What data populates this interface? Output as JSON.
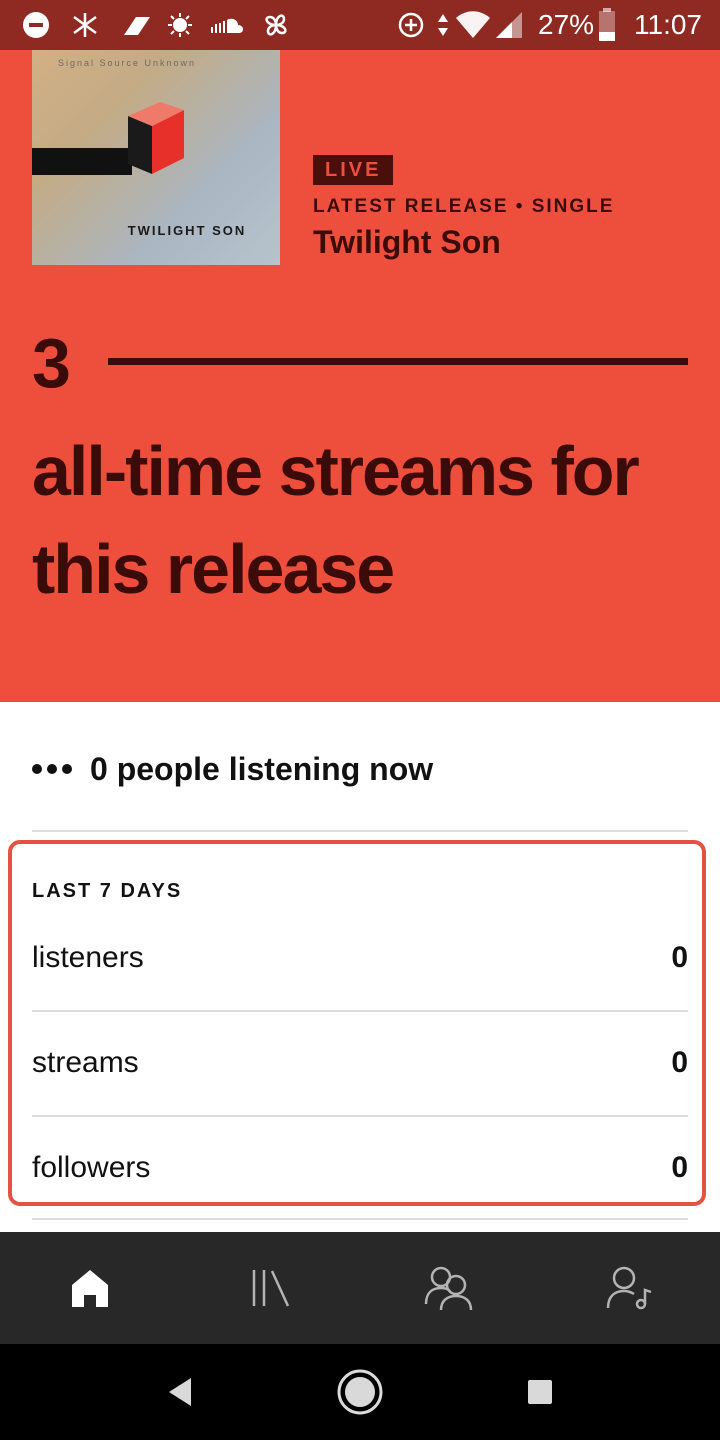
{
  "status_bar": {
    "battery_percent": "27%",
    "time": "11:07",
    "icons": [
      "dnd-icon",
      "bluetooth-icon",
      "edit-icon",
      "brightness-icon",
      "soundcloud-icon",
      "pinwheel-icon",
      "data-saver-icon",
      "data-arrows-icon",
      "wifi-icon",
      "signal-icon",
      "battery-icon"
    ]
  },
  "release": {
    "cover_source_text": "Signal Source Unknown",
    "cover_title": "TWILIGHT SON",
    "badge": "LIVE",
    "meta": "LATEST RELEASE • SINGLE",
    "title": "Twilight Son"
  },
  "streams": {
    "count": "3",
    "caption": "all-time streams for this release"
  },
  "listening_now": {
    "text": "0 people listening now"
  },
  "last_7_days": {
    "heading": "LAST 7 DAYS",
    "rows": [
      {
        "label": "listeners",
        "value": "0"
      },
      {
        "label": "streams",
        "value": "0"
      },
      {
        "label": "followers",
        "value": "0"
      }
    ]
  },
  "bottom_nav": {
    "items": [
      {
        "icon": "home-icon",
        "active": true
      },
      {
        "icon": "library-icon",
        "active": false
      },
      {
        "icon": "audience-icon",
        "active": false
      },
      {
        "icon": "artist-profile-icon",
        "active": false
      }
    ]
  },
  "colors": {
    "hero_bg": "#ee4f3d",
    "hero_text": "#3b0b09",
    "status_bar": "#8f2a22",
    "card_border": "#e35342",
    "nav_bg": "#282828"
  }
}
